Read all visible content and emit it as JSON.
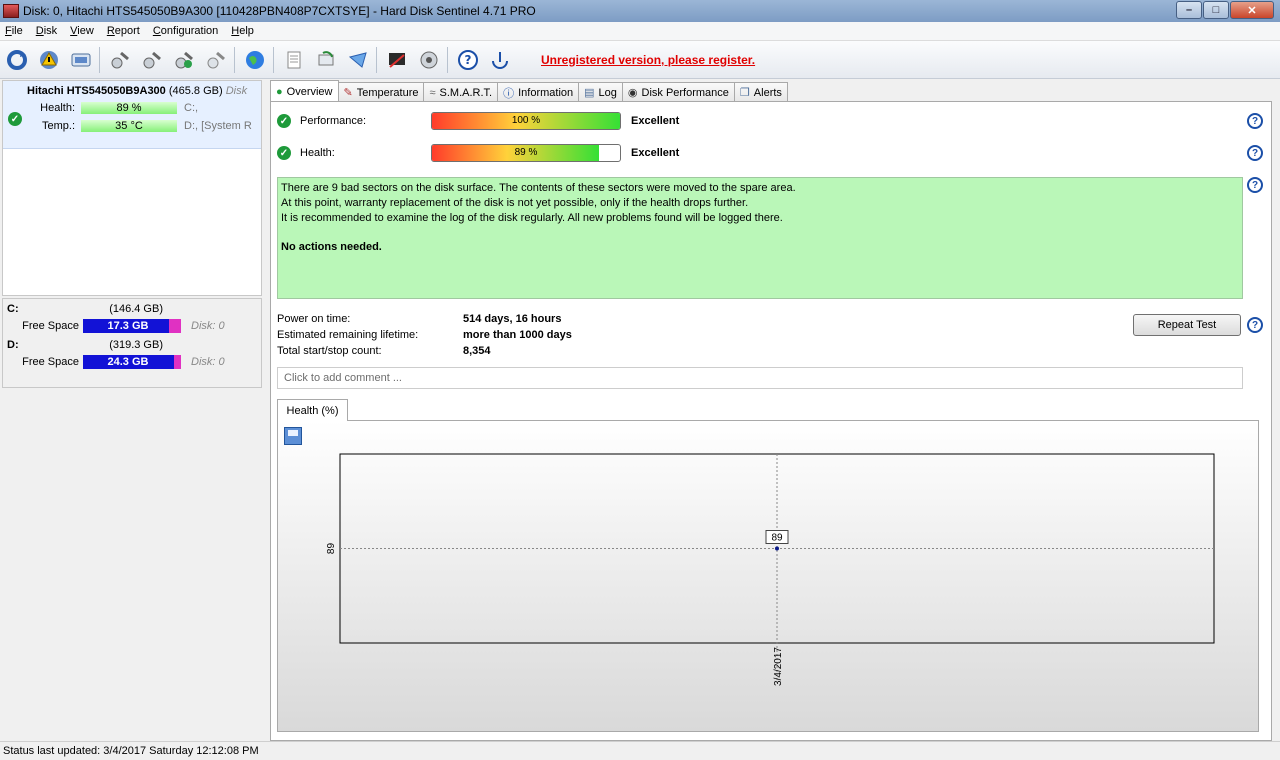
{
  "window": {
    "title": "Disk: 0, Hitachi HTS545050B9A300 [110428PBN408P7CXTSYE]  -  Hard Disk Sentinel 4.71 PRO",
    "min": "–",
    "max": "□",
    "close": "✕"
  },
  "menu": [
    {
      "u": "F",
      "rest": "ile"
    },
    {
      "u": "D",
      "rest": "isk"
    },
    {
      "u": "V",
      "rest": "iew"
    },
    {
      "u": "R",
      "rest": "eport"
    },
    {
      "u": "C",
      "rest": "onfiguration"
    },
    {
      "u": "H",
      "rest": "elp"
    }
  ],
  "toolbar": {
    "unregistered": "Unregistered version, please register."
  },
  "left": {
    "disk": {
      "model": "Hitachi HTS545050B9A300",
      "size": " (465.8 GB) ",
      "suffix": "Disk",
      "health_label": "Health:",
      "health_value": "89 %",
      "health_drives": "C:,",
      "temp_label": "Temp.:",
      "temp_value": "35 °C",
      "temp_drives": "D:, [System R"
    },
    "volumes": [
      {
        "letter": "C:",
        "size": "(146.4 GB)",
        "free_label": "Free Space",
        "free_value": "17.3 GB",
        "disk": "Disk: 0",
        "free_fraction": 0.118
      },
      {
        "letter": "D:",
        "size": "(319.3 GB)",
        "free_label": "Free Space",
        "free_value": "24.3 GB",
        "disk": "Disk: 0",
        "free_fraction": 0.076
      }
    ]
  },
  "tabs": [
    {
      "label": "Overview",
      "icon": "check-icon"
    },
    {
      "label": "Temperature",
      "icon": "thermometer-icon"
    },
    {
      "label": "S.M.A.R.T.",
      "icon": "smart-icon"
    },
    {
      "label": "Information",
      "icon": "info-icon"
    },
    {
      "label": "Log",
      "icon": "log-icon"
    },
    {
      "label": "Disk Performance",
      "icon": "performance-icon"
    },
    {
      "label": "Alerts",
      "icon": "alerts-icon"
    }
  ],
  "overview": {
    "performance": {
      "label": "Performance:",
      "value_text": "100 %",
      "value": 100,
      "rating": "Excellent"
    },
    "health": {
      "label": "Health:",
      "value_text": "89 %",
      "value": 89,
      "rating": "Excellent"
    },
    "message": {
      "line1": "There are 9 bad sectors on the disk surface. The contents of these sectors were moved to the spare area.",
      "line2": "At this point, warranty replacement of the disk is not yet possible, only if the health drops further.",
      "line3": "It is recommended to examine the log of the disk regularly. All new problems found will be logged there.",
      "action": "No actions needed."
    },
    "info": {
      "power_on_label": "Power on time:",
      "power_on_value": "514 days, 16 hours",
      "lifetime_label": "Estimated remaining lifetime:",
      "lifetime_value": "more than 1000 days",
      "startstop_label": "Total start/stop count:",
      "startstop_value": "8,354"
    },
    "repeat_button": "Repeat Test",
    "comment_placeholder": "Click to add comment ...",
    "help": "?"
  },
  "chart_tab": "Health (%)",
  "chart_data": {
    "type": "line",
    "x": [
      "3/4/2017"
    ],
    "series": [
      {
        "values": [
          89
        ]
      }
    ],
    "y_ticks": [
      89
    ],
    "data_labels": [
      "89"
    ],
    "grid": true
  },
  "statusbar": "Status last updated: 3/4/2017 Saturday 12:12:08 PM"
}
